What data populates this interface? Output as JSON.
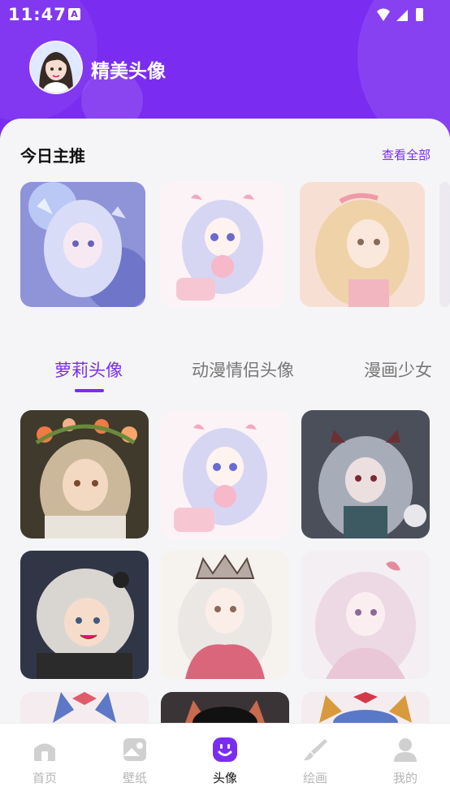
{
  "status_bar": {
    "time": "11:47",
    "notif_letter": "A"
  },
  "header": {
    "app_title": "精美头像"
  },
  "featured": {
    "title": "今日主推",
    "see_all": "查看全部"
  },
  "tabs": [
    "萝莉头像",
    "动漫情侣头像",
    "漫画少女"
  ],
  "active_tab": 0,
  "nav": {
    "items": [
      "首页",
      "壁纸",
      "头像",
      "绘画",
      "我的"
    ],
    "active_index": 2
  },
  "colors": {
    "accent": "#7a2cf0",
    "bg": "#f5f5f7",
    "nav_inactive": "#b5b5b5"
  }
}
